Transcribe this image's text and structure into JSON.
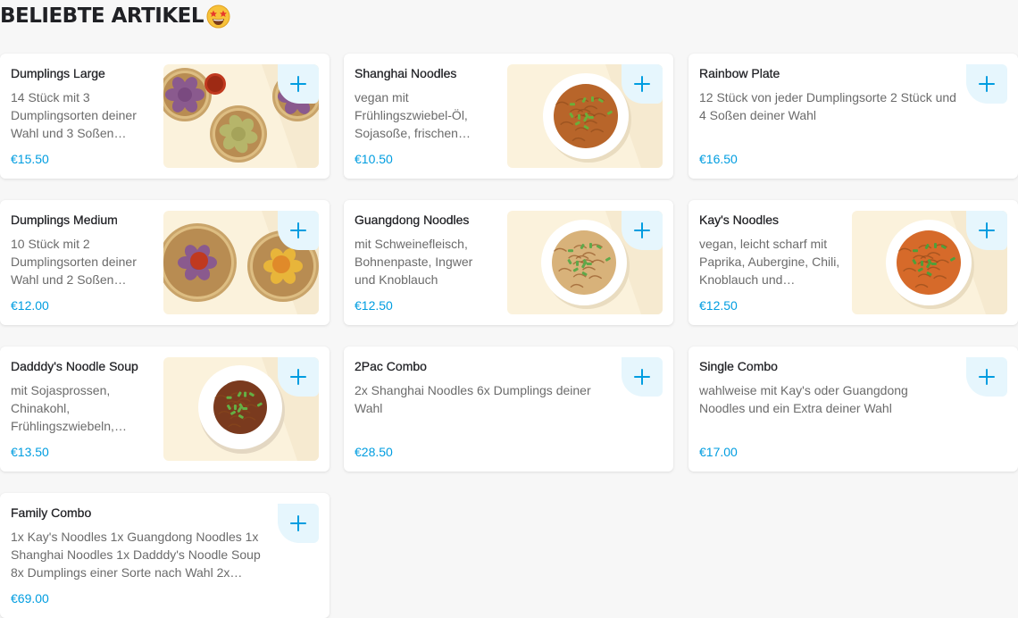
{
  "section": {
    "title": "BELIEBTE ARTIKEL",
    "emoji_icon": "star-struck-emoji-icon"
  },
  "colors": {
    "price": "#009de0",
    "add_button_bg": "#e6f6fd",
    "add_button_icon": "#009de0"
  },
  "items": [
    {
      "name": "Dumplings Large",
      "description": "14 Stück mit 3 Dumplingsorten deiner Wahl und 3 Soßen…",
      "price": "€15.50",
      "image": "dumplings-large-photo"
    },
    {
      "name": "Shanghai Noodles",
      "description": "vegan mit Frühlingszwiebel-Öl, Sojasoße, frischen…",
      "price": "€10.50",
      "image": "shanghai-noodles-photo"
    },
    {
      "name": "Rainbow Plate",
      "description": "12 Stück von jeder Dumplingsorte 2 Stück und 4 Soßen deiner Wahl",
      "price": "€16.50",
      "image": null
    },
    {
      "name": "Dumplings Medium",
      "description": "10 Stück mit 2 Dumplingsorten deiner Wahl und 2 Soßen…",
      "price": "€12.00",
      "image": "dumplings-medium-photo"
    },
    {
      "name": "Guangdong Noodles",
      "description": "mit Schweinefleisch, Bohnenpaste, Ingwer und Knoblauch",
      "price": "€12.50",
      "image": "guangdong-noodles-photo"
    },
    {
      "name": "Kay's Noodles",
      "description": "vegan, leicht scharf mit Paprika, Aubergine, Chili, Knoblauch und…",
      "price": "€12.50",
      "image": "kays-noodles-photo"
    },
    {
      "name": "Dadddy's Noodle Soup",
      "description": "mit Sojasprossen, Chinakohl, Frühlingszwiebeln,…",
      "price": "€13.50",
      "image": "noodle-soup-photo"
    },
    {
      "name": "2Pac Combo",
      "description": "2x Shanghai Noodles 6x Dumplings deiner Wahl",
      "price": "€28.50",
      "image": null
    },
    {
      "name": "Single Combo",
      "description": "wahlweise mit Kay's oder Guangdong Noodles und ein Extra deiner Wahl",
      "price": "€17.00",
      "image": null
    },
    {
      "name": "Family Combo",
      "description": "1x Kay's Noodles 1x Guangdong Noodles 1x Shanghai Noodles 1x Dadddy's Noodle Soup 8x Dumplings einer Sorte nach Wahl 2x…",
      "price": "€69.00",
      "image": null
    }
  ]
}
